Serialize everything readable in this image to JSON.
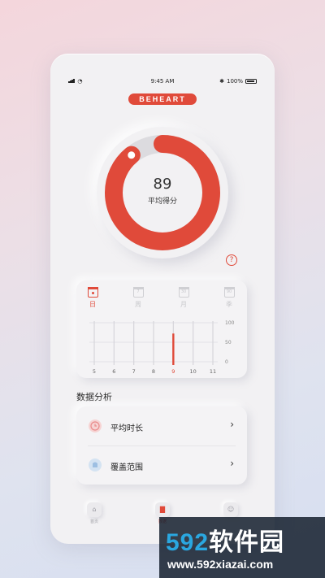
{
  "status_bar": {
    "time": "9:45 AM",
    "battery": "100%"
  },
  "brand": "BEHEART",
  "score": {
    "value": "89",
    "label": "平均得分",
    "fill": 0.89
  },
  "period_tabs": [
    {
      "label": "日",
      "day": "",
      "active": true
    },
    {
      "label": "周",
      "day": "7",
      "active": false
    },
    {
      "label": "月",
      "day": "30",
      "active": false
    },
    {
      "label": "季",
      "day": "90",
      "active": false
    }
  ],
  "chart_data": {
    "type": "bar",
    "categories": [
      "5",
      "6",
      "7",
      "8",
      "9",
      "10",
      "11"
    ],
    "values": [
      0,
      0,
      0,
      0,
      89,
      0,
      0
    ],
    "ylim": [
      0,
      100
    ],
    "yticks": [
      "100",
      "50",
      "0"
    ],
    "highlight_index": 4,
    "accent": "#e04a3a"
  },
  "section_title": "数据分析",
  "analysis_items": [
    {
      "label": "平均时长",
      "icon": "clock-icon",
      "color": "#f2a8a8"
    },
    {
      "label": "覆盖范围",
      "icon": "coverage-icon",
      "color": "#a8c8e8"
    }
  ],
  "nav": [
    {
      "label": "首页",
      "icon": "home-icon",
      "active": false
    },
    {
      "label": "数据",
      "icon": "chart-icon",
      "active": true
    },
    {
      "label": "",
      "icon": "profile-icon",
      "active": false
    }
  ],
  "watermark": {
    "text": "592软件园",
    "url": "www.592xiazai.com"
  }
}
